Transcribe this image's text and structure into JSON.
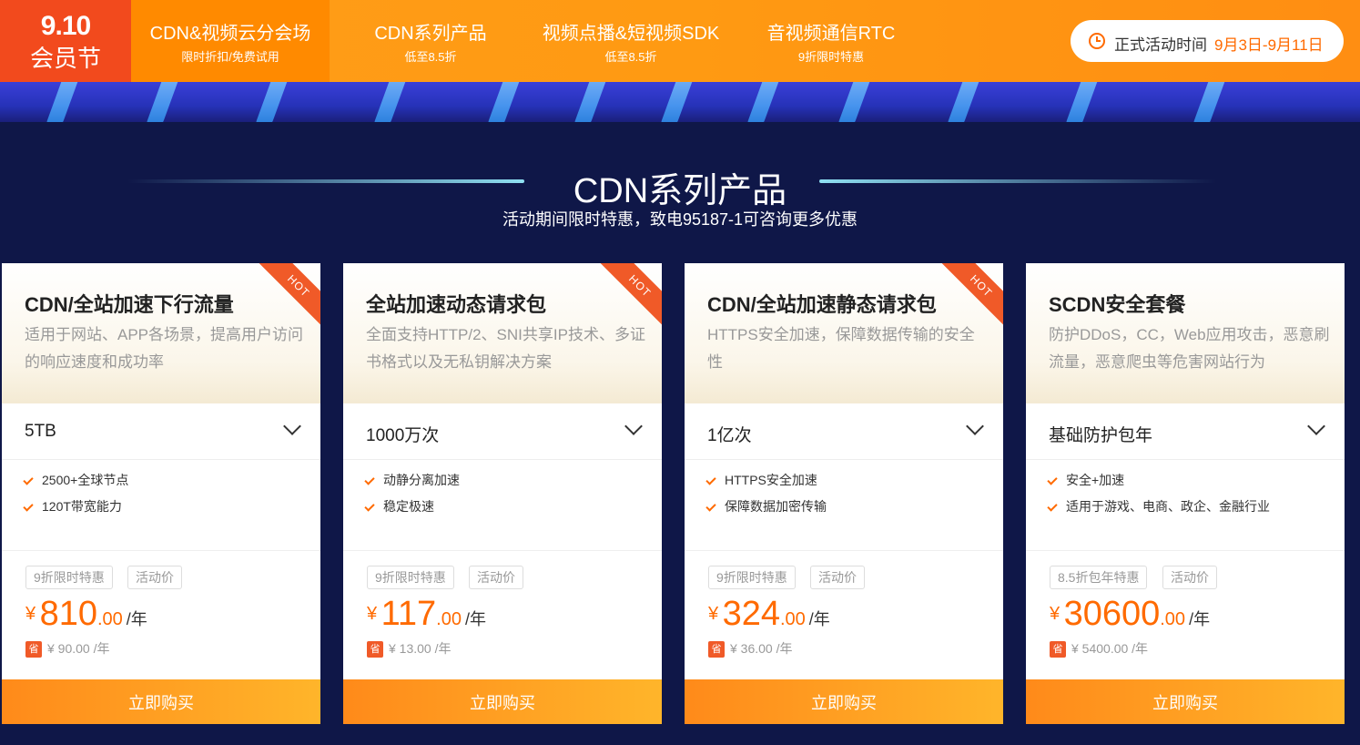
{
  "logo": {
    "line1": "9.10",
    "line2": "会员节"
  },
  "nav": [
    {
      "title": "CDN&视频云分会场",
      "sub": "限时折扣/免费试用"
    },
    {
      "title": "CDN系列产品",
      "sub": "低至8.5折"
    },
    {
      "title": "视频点播&短视频SDK",
      "sub": "低至8.5折"
    },
    {
      "title": "音视频通信RTC",
      "sub": "9折限时特惠"
    }
  ],
  "activity": {
    "label": "正式活动时间",
    "value": "9月3日-9月11日"
  },
  "section": {
    "title": "CDN系列产品",
    "subtitle": "活动期间限时特惠，致电95187-1可咨询更多优惠"
  },
  "cards": [
    {
      "name": "CDN/全站加速下行流量",
      "desc": "适用于网站、APP各场景，提高用户访问的响应速度和成功率",
      "hot": "HOT",
      "spec": "5TB",
      "features": [
        "2500+全球节点",
        "120T带宽能力"
      ],
      "tag1": "9折限时特惠",
      "tag2": "活动价",
      "currency": "¥",
      "price_int": "810",
      "price_dec": ".00",
      "unit": "/年",
      "save_badge": "省",
      "save": "¥ 90.00 /年",
      "buy": "立即购买"
    },
    {
      "name": "全站加速动态请求包",
      "desc": "全面支持HTTP/2、SNI共享IP技术、多证书格式以及无私钥解决方案",
      "hot": "HOT",
      "spec": "1000万次",
      "features": [
        "动静分离加速",
        "稳定极速"
      ],
      "tag1": "9折限时特惠",
      "tag2": "活动价",
      "currency": "¥",
      "price_int": "117",
      "price_dec": ".00",
      "unit": "/年",
      "save_badge": "省",
      "save": "¥ 13.00 /年",
      "buy": "立即购买"
    },
    {
      "name": "CDN/全站加速静态请求包",
      "desc": "HTTPS安全加速，保障数据传输的安全性",
      "hot": "HOT",
      "spec": "1亿次",
      "features": [
        "HTTPS安全加速",
        "保障数据加密传输"
      ],
      "tag1": "9折限时特惠",
      "tag2": "活动价",
      "currency": "¥",
      "price_int": "324",
      "price_dec": ".00",
      "unit": "/年",
      "save_badge": "省",
      "save": "¥ 36.00 /年",
      "buy": "立即购买"
    },
    {
      "name": "SCDN安全套餐",
      "desc": "防护DDoS，CC，Web应用攻击，恶意刷流量，恶意爬虫等危害网站行为",
      "hot": "",
      "spec": "基础防护包年",
      "features": [
        "安全+加速",
        "适用于游戏、电商、政企、金融行业"
      ],
      "tag1": "8.5折包年特惠",
      "tag2": "活动价",
      "currency": "¥",
      "price_int": "30600",
      "price_dec": ".00",
      "unit": "/年",
      "save_badge": "省",
      "save": "¥ 5400.00 /年",
      "buy": "立即购买"
    }
  ]
}
